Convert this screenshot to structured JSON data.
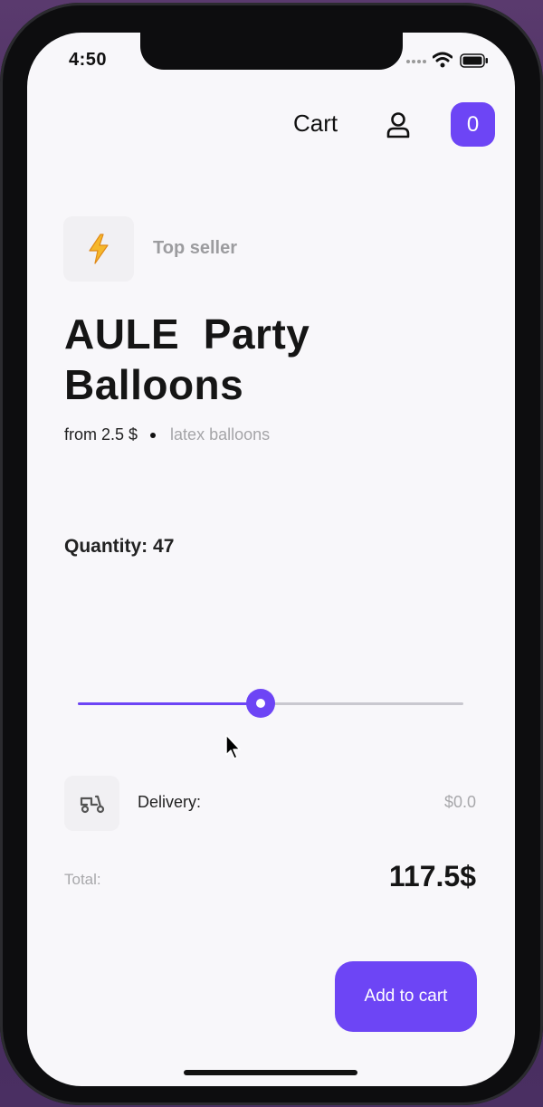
{
  "status_bar": {
    "time": "4:50"
  },
  "header": {
    "title": "Cart",
    "cart_count": "0",
    "icons": [
      "person-icon"
    ]
  },
  "product": {
    "badge_icon": "lightning-icon",
    "badge_label": "Top seller",
    "title": "AULE  Party\nBalloons",
    "price_from": "from 2.5 $",
    "category": "latex balloons"
  },
  "quantity": {
    "label": "Quantity:",
    "value": "47",
    "slider_fraction": 0.475
  },
  "delivery": {
    "icon": "scooter-icon",
    "label": "Delivery:",
    "value": "$0.0"
  },
  "total": {
    "label": "Total:",
    "value": "117.5$"
  },
  "actions": {
    "add_to_cart_label": "Add to cart"
  },
  "colors": {
    "accent": "#6d45f5",
    "muted_text": "#a8a8ab",
    "background": "#f8f7fa"
  }
}
